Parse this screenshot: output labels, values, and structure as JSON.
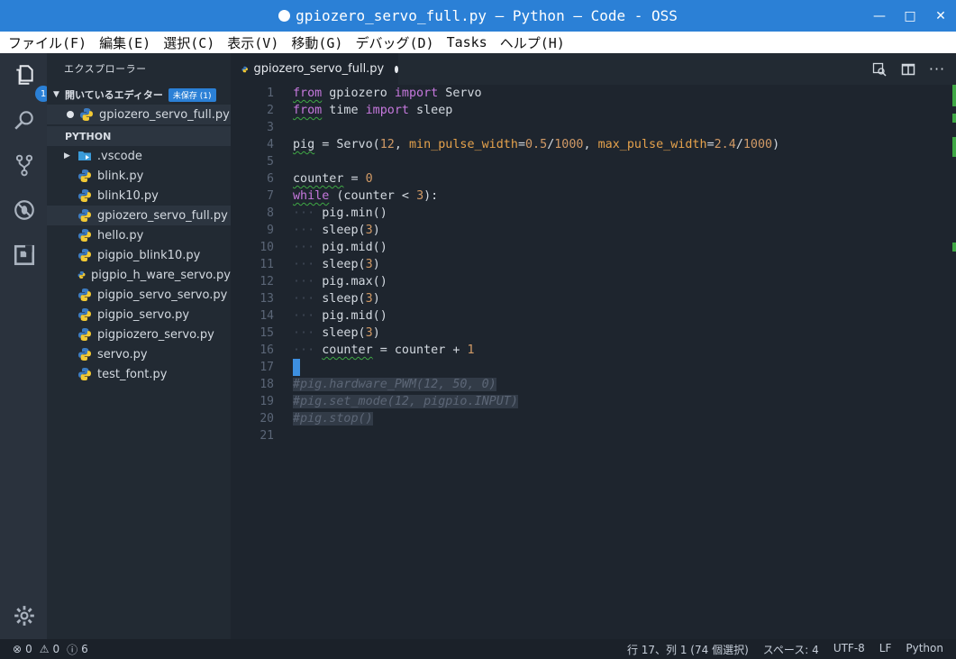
{
  "window": {
    "title": "gpiozero_servo_full.py — Python — Code - OSS"
  },
  "menu": [
    "ファイル(F)",
    "編集(E)",
    "選択(C)",
    "表示(V)",
    "移動(G)",
    "デバッグ(D)",
    "Tasks",
    "ヘルプ(H)"
  ],
  "activity": {
    "explorer_badge": "1"
  },
  "sidebar": {
    "title": "エクスプローラー",
    "open_editors_header": "開いているエディター",
    "unsaved_badge": "未保存 (1)",
    "open_editors": [
      "gpiozero_servo_full.py"
    ],
    "folder_header": "PYTHON",
    "folder_items": [
      ".vscode"
    ],
    "files": [
      "blink.py",
      "blink10.py",
      "gpiozero_servo_full.py",
      "hello.py",
      "pigpio_blink10.py",
      "pigpio_h_ware_servo.py",
      "pigpio_servo_servo.py",
      "pigpio_servo.py",
      "pigpiozero_servo.py",
      "servo.py",
      "test_font.py"
    ]
  },
  "tab": {
    "label": "gpiozero_servo_full.py"
  },
  "editor": {
    "line_numbers": [
      "1",
      "2",
      "3",
      "4",
      "5",
      "6",
      "7",
      "8",
      "9",
      "10",
      "11",
      "12",
      "13",
      "14",
      "15",
      "16",
      "17",
      "18",
      "19",
      "20",
      "21"
    ],
    "t": {
      "from": "from",
      "import": "import",
      "l1_mod": " gpiozero ",
      "l1_cls": " Servo",
      "l2_mod": " time ",
      "l2_fn": " sleep",
      "l4_a": "pig",
      "l4_b": " = Servo(",
      "l4_n1": "12",
      "l4_c": ", ",
      "l4_p1": "min_pulse_width",
      "l4_eq1": "=",
      "l4_n2": "0.5",
      "l4_sl1": "/",
      "l4_n3": "1000",
      "l4_d": ", ",
      "l4_p2": "max_pulse_width",
      "l4_eq2": "=",
      "l4_n4": "2.4",
      "l4_sl2": "/",
      "l4_n5": "1000",
      "l4_e": ")",
      "l6_a": "counter",
      "l6_b": " = ",
      "l6_n": "0",
      "while": "while",
      "l7_b": " (counter < ",
      "l7_n": "3",
      "l7_c": "):",
      "indent": "···",
      "pig_min": "pig.min()",
      "pig_mid": "pig.mid()",
      "pig_max": "pig.max()",
      "sleep_open": "sleep(",
      "sleep_n": "3",
      "close": ")",
      "l16_a": "counter",
      "l16_b": " = counter + ",
      "l16_n": "1",
      "l18": "#pig.hardware_PWM(12, 50, 0)",
      "l19": "#pig.set_mode(12, pigpio.INPUT)",
      "l20": "#pig.stop()"
    }
  },
  "status": {
    "errors": "0",
    "warnings": "0",
    "info": "6",
    "position": "行 17、列 1 (74 個選択)",
    "spaces": "スペース: 4",
    "encoding": "UTF-8",
    "eol": "LF",
    "language": "Python"
  }
}
